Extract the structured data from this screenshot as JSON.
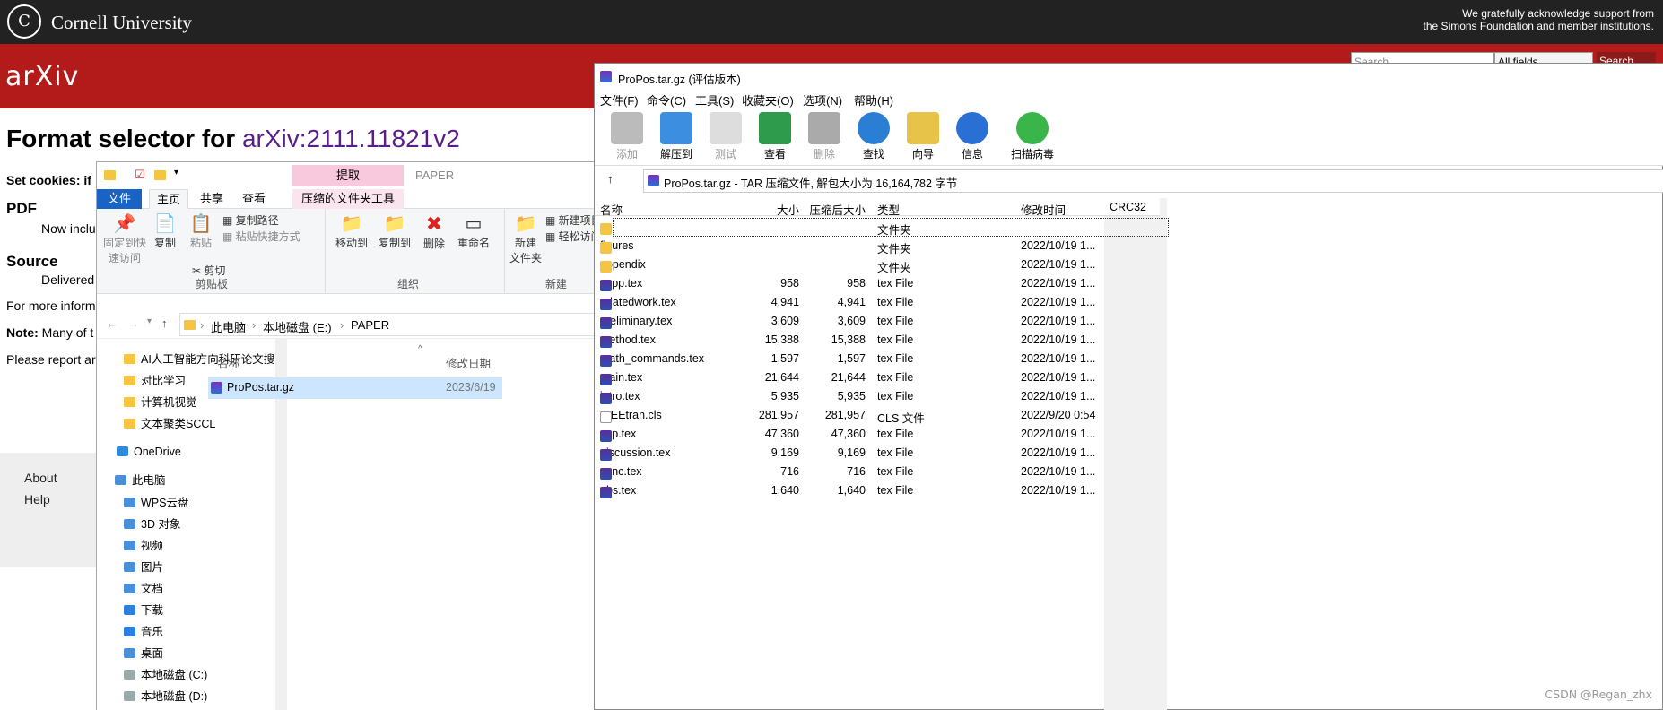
{
  "cornell": {
    "logo_text": "C",
    "name": "Cornell University",
    "ack_line1": "We gratefully acknowledge support from",
    "ack_line2": "the Simons Foundation and member institutions."
  },
  "arxiv": {
    "logo": "arXiv",
    "search_placeholder": "Search...",
    "fields": "All fields",
    "search_btn": "Search",
    "title_prefix": "Format selector for ",
    "title_id": "arXiv:2111.11821v2",
    "set_cookies": "Set cookies: if",
    "pdf": "PDF",
    "now_inc": "Now inclu",
    "source": "Source",
    "delivered": "Delivered",
    "formore": "For more inform",
    "note_label": "Note:",
    "note_text": " Many of t",
    "please": "Please report ar",
    "about": "About",
    "help": "Help"
  },
  "explorer": {
    "extract_tab": "提取",
    "paper_title": "PAPER",
    "tabs": [
      "文件",
      "主页",
      "共享",
      "查看",
      "压缩的文件夹工具"
    ],
    "ribbon": {
      "pin": "固定到快\n速访问",
      "copy": "复制",
      "paste": "粘贴",
      "copy_path": "复制路径",
      "paste_shortcut": "粘贴快捷方式",
      "cut": "剪切",
      "move_to": "移动到",
      "copy_to": "复制到",
      "delete": "删除",
      "rename": "重命名",
      "new_folder": "新建\n文件夹",
      "new_item": "新建项目",
      "easy_access": "轻松访问",
      "grp_clipboard": "剪贴板",
      "grp_organize": "组织",
      "grp_new": "新建"
    },
    "breadcrumb": [
      "此电脑",
      "本地磁盘 (E:)",
      "PAPER"
    ],
    "nav": [
      "AI人工智能方向科研论文搜",
      "对比学习",
      "计算机视觉",
      "文本聚类SCCL",
      "OneDrive",
      "此电脑",
      "WPS云盘",
      "3D 对象",
      "视频",
      "图片",
      "文档",
      "下载",
      "音乐",
      "桌面",
      "本地磁盘 (C:)",
      "本地磁盘 (D:)"
    ],
    "col_name": "名称",
    "col_date": "修改日期",
    "file": {
      "name": "ProPos.tar.gz",
      "date": "2023/6/19"
    }
  },
  "winrar": {
    "title": "ProPos.tar.gz (评估版本)",
    "menu": [
      "文件(F)",
      "命令(C)",
      "工具(S)",
      "收藏夹(O)",
      "选项(N)",
      "帮助(H)"
    ],
    "toolbar": [
      "添加",
      "解压到",
      "测试",
      "查看",
      "删除",
      "查找",
      "向导",
      "信息",
      "扫描病毒"
    ],
    "path": "ProPos.tar.gz - TAR 压缩文件, 解包大小为 16,164,782 字节",
    "headers": [
      "名称",
      "大小",
      "压缩后大小",
      "类型",
      "修改时间",
      "CRC32"
    ],
    "rows": [
      {
        "name": "..",
        "size": "",
        "packed": "",
        "type": "文件夹",
        "mtime": ""
      },
      {
        "name": "figures",
        "size": "",
        "packed": "",
        "type": "文件夹",
        "mtime": "2022/10/19 1..."
      },
      {
        "name": "appendix",
        "size": "",
        "packed": "",
        "type": "文件夹",
        "mtime": "2022/10/19 1..."
      },
      {
        "name": "supp.tex",
        "size": "958",
        "packed": "958",
        "type": "tex File",
        "mtime": "2022/10/19 1..."
      },
      {
        "name": "relatedwork.tex",
        "size": "4,941",
        "packed": "4,941",
        "type": "tex File",
        "mtime": "2022/10/19 1..."
      },
      {
        "name": "preliminary.tex",
        "size": "3,609",
        "packed": "3,609",
        "type": "tex File",
        "mtime": "2022/10/19 1..."
      },
      {
        "name": "method.tex",
        "size": "15,388",
        "packed": "15,388",
        "type": "tex File",
        "mtime": "2022/10/19 1..."
      },
      {
        "name": "math_commands.tex",
        "size": "1,597",
        "packed": "1,597",
        "type": "tex File",
        "mtime": "2022/10/19 1..."
      },
      {
        "name": "main.tex",
        "size": "21,644",
        "packed": "21,644",
        "type": "tex File",
        "mtime": "2022/10/19 1..."
      },
      {
        "name": "intro.tex",
        "size": "5,935",
        "packed": "5,935",
        "type": "tex File",
        "mtime": "2022/10/19 1..."
      },
      {
        "name": "IEEEtran.cls",
        "size": "281,957",
        "packed": "281,957",
        "type": "CLS 文件",
        "mtime": "2022/9/20 0:54"
      },
      {
        "name": "exp.tex",
        "size": "47,360",
        "packed": "47,360",
        "type": "tex File",
        "mtime": "2022/10/19 1..."
      },
      {
        "name": "discussion.tex",
        "size": "9,169",
        "packed": "9,169",
        "type": "tex File",
        "mtime": "2022/10/19 1..."
      },
      {
        "name": "conc.tex",
        "size": "716",
        "packed": "716",
        "type": "tex File",
        "mtime": "2022/10/19 1..."
      },
      {
        "name": "abs.tex",
        "size": "1,640",
        "packed": "1,640",
        "type": "tex File",
        "mtime": "2022/10/19 1..."
      }
    ]
  },
  "watermark": "CSDN @Regan_zhx"
}
